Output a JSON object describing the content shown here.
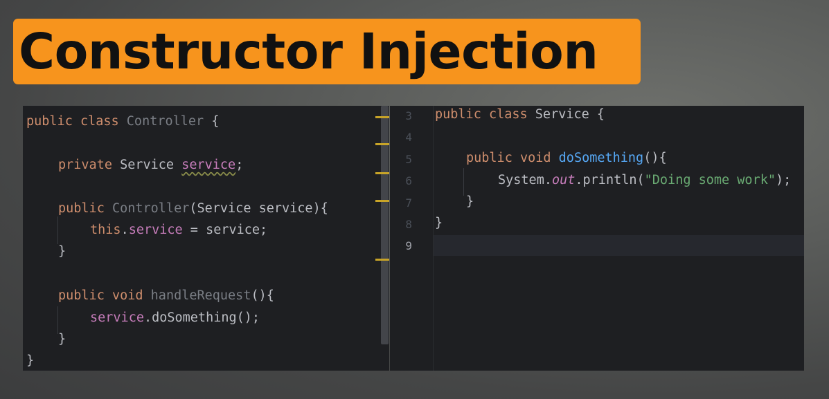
{
  "title": "Constructor Injection",
  "left_code": {
    "l1": [
      "public",
      " class",
      " Controller",
      " {"
    ],
    "l2": [
      "private",
      " Service ",
      "service",
      ";"
    ],
    "l3": [
      "public",
      " Controller",
      "(Service service){"
    ],
    "l4": [
      "this",
      ".",
      "service",
      " = service;"
    ],
    "l5": "}",
    "l6": [
      "public",
      " void",
      " handleRequest",
      "(){"
    ],
    "l7": [
      "service",
      ".doSomething();"
    ],
    "l8": "}",
    "l9": "}"
  },
  "right_code": {
    "line_numbers": [
      "3",
      "4",
      "5",
      "6",
      "7",
      "8",
      "9"
    ],
    "l3": [
      "public",
      " class",
      " Service {"
    ],
    "l5": [
      "public",
      " void",
      " doSomething",
      "(){"
    ],
    "l6": [
      "System.",
      "out",
      ".println(",
      "\"Doing some work\"",
      ");"
    ],
    "l7": "}",
    "l8": "}"
  }
}
